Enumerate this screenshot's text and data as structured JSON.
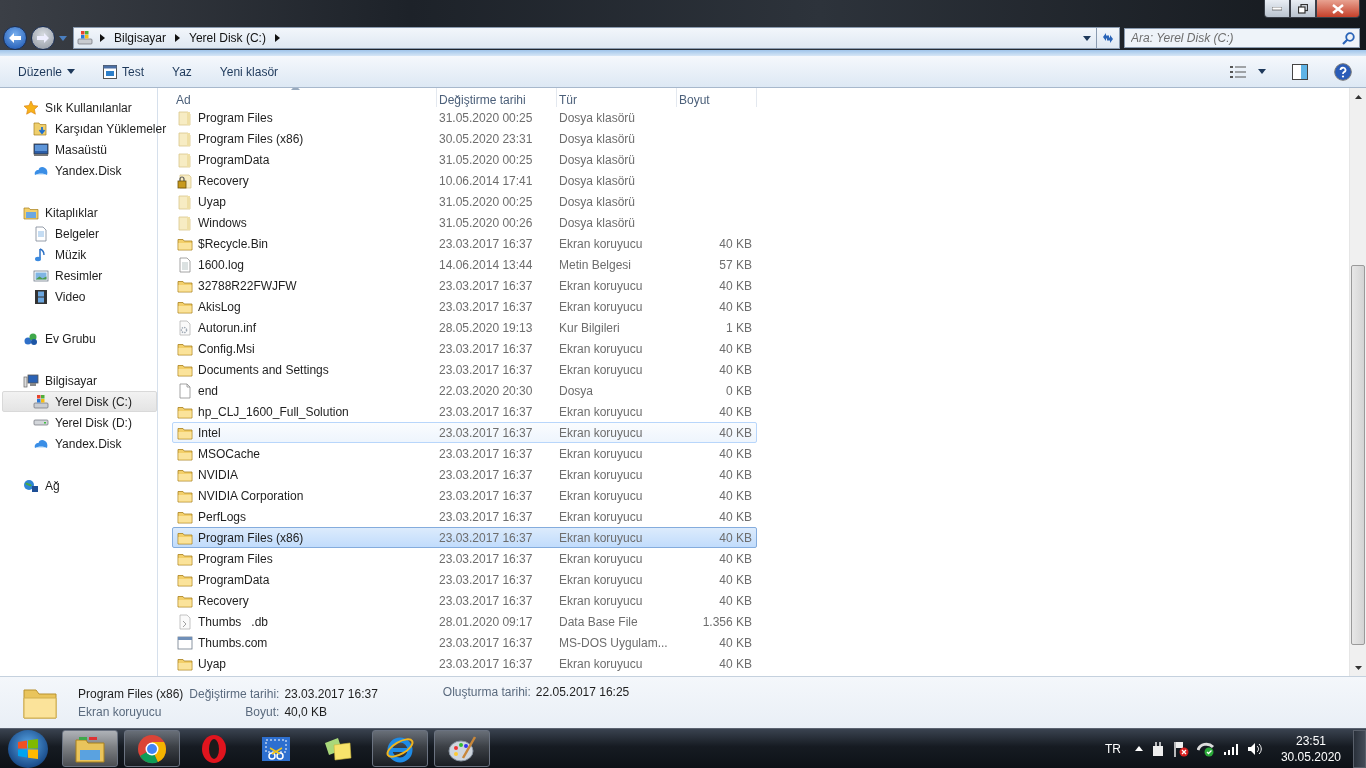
{
  "window": {
    "controls": [
      {
        "kind": "minimize"
      },
      {
        "kind": "restore"
      },
      {
        "kind": "close"
      }
    ]
  },
  "address_bar": {
    "breadcrumbs": [
      "Bilgisayar",
      "Yerel Disk (C:)"
    ]
  },
  "search": {
    "placeholder": "Ara: Yerel Disk (C:)"
  },
  "toolbar": {
    "items": [
      {
        "label": "Düzenle",
        "kind": "menu"
      },
      {
        "label": "Test",
        "kind": "icon"
      },
      {
        "label": "Yaz",
        "kind": "plain"
      },
      {
        "label": "Yeni klasör",
        "kind": "plain"
      }
    ]
  },
  "sidebar": {
    "groups": [
      {
        "label": "Sık Kullanılanlar",
        "kind": "star",
        "selected": false,
        "children": [
          {
            "label": "Karşıdan Yüklemeler",
            "kind": "download",
            "selected": false
          },
          {
            "label": "Masaüstü",
            "kind": "desktop",
            "selected": false
          },
          {
            "label": "Yandex.Disk",
            "kind": "cloud",
            "selected": false
          }
        ]
      },
      {
        "label": "Kitaplıklar",
        "kind": "library",
        "selected": false,
        "children": [
          {
            "label": "Belgeler",
            "kind": "document",
            "selected": false
          },
          {
            "label": "Müzik",
            "kind": "music",
            "selected": false
          },
          {
            "label": "Resimler",
            "kind": "picture",
            "selected": false
          },
          {
            "label": "Video",
            "kind": "film",
            "selected": false
          }
        ]
      },
      {
        "label": "Ev Grubu",
        "kind": "homegroup",
        "selected": false
      },
      {
        "label": "Bilgisayar",
        "kind": "computer",
        "selected": false,
        "children": [
          {
            "label": "Yerel Disk (C:)",
            "kind": "system-drive",
            "selected": true
          },
          {
            "label": "Yerel Disk (D:)",
            "kind": "drive",
            "selected": false
          },
          {
            "label": "Yandex.Disk",
            "kind": "cloud",
            "selected": false
          }
        ]
      },
      {
        "label": "Ağ",
        "kind": "network",
        "selected": false
      }
    ]
  },
  "files": {
    "columns": [
      "Ad",
      "Değiştirme tarihi",
      "Tür",
      "Boyut"
    ],
    "rows": [
      {
        "name": "Program Files",
        "modified": "31.05.2020 00:25",
        "type": "Dosya klasörü",
        "size": "",
        "kind": "pale-folder",
        "selected": false,
        "hovered": false
      },
      {
        "name": "Program Files (x86)",
        "modified": "30.05.2020 23:31",
        "type": "Dosya klasörü",
        "size": "",
        "kind": "pale-folder",
        "selected": false,
        "hovered": false
      },
      {
        "name": "ProgramData",
        "modified": "31.05.2020 00:25",
        "type": "Dosya klasörü",
        "size": "",
        "kind": "pale-folder",
        "selected": false,
        "hovered": false
      },
      {
        "name": "Recovery",
        "modified": "10.06.2014 17:41",
        "type": "Dosya klasörü",
        "size": "",
        "kind": "locked-folder",
        "selected": false,
        "hovered": false
      },
      {
        "name": "Uyap",
        "modified": "31.05.2020 00:25",
        "type": "Dosya klasörü",
        "size": "",
        "kind": "pale-folder",
        "selected": false,
        "hovered": false
      },
      {
        "name": "Windows",
        "modified": "31.05.2020 00:26",
        "type": "Dosya klasörü",
        "size": "",
        "kind": "pale-folder",
        "selected": false,
        "hovered": false
      },
      {
        "name": "$Recycle.Bin",
        "modified": "23.03.2017 16:37",
        "type": "Ekran koruyucu",
        "size": "40 KB",
        "kind": "folder",
        "selected": false,
        "hovered": false
      },
      {
        "name": "1600.log",
        "modified": "14.06.2014 13:44",
        "type": "Metin Belgesi",
        "size": "57 KB",
        "kind": "text",
        "selected": false,
        "hovered": false
      },
      {
        "name": "32788R22FWJFW",
        "modified": "23.03.2017 16:37",
        "type": "Ekran koruyucu",
        "size": "40 KB",
        "kind": "folder",
        "selected": false,
        "hovered": false
      },
      {
        "name": "AkisLog",
        "modified": "23.03.2017 16:37",
        "type": "Ekran koruyucu",
        "size": "40 KB",
        "kind": "folder",
        "selected": false,
        "hovered": false
      },
      {
        "name": "Autorun.inf",
        "modified": "28.05.2020 19:13",
        "type": "Kur Bilgileri",
        "size": "1 KB",
        "kind": "config",
        "selected": false,
        "hovered": false
      },
      {
        "name": "Config.Msi",
        "modified": "23.03.2017 16:37",
        "type": "Ekran koruyucu",
        "size": "40 KB",
        "kind": "folder",
        "selected": false,
        "hovered": false
      },
      {
        "name": "Documents and Settings",
        "modified": "23.03.2017 16:37",
        "type": "Ekran koruyucu",
        "size": "40 KB",
        "kind": "folder",
        "selected": false,
        "hovered": false
      },
      {
        "name": "end",
        "modified": "22.03.2020 20:30",
        "type": "Dosya",
        "size": "0 KB",
        "kind": "blank",
        "selected": false,
        "hovered": false
      },
      {
        "name": "hp_CLJ_1600_Full_Solution",
        "modified": "23.03.2017 16:37",
        "type": "Ekran koruyucu",
        "size": "40 KB",
        "kind": "folder",
        "selected": false,
        "hovered": false
      },
      {
        "name": "Intel",
        "modified": "23.03.2017 16:37",
        "type": "Ekran koruyucu",
        "size": "40 KB",
        "kind": "folder",
        "selected": false,
        "hovered": true
      },
      {
        "name": "MSOCache",
        "modified": "23.03.2017 16:37",
        "type": "Ekran koruyucu",
        "size": "40 KB",
        "kind": "folder",
        "selected": false,
        "hovered": false
      },
      {
        "name": "NVIDIA",
        "modified": "23.03.2017 16:37",
        "type": "Ekran koruyucu",
        "size": "40 KB",
        "kind": "folder",
        "selected": false,
        "hovered": false
      },
      {
        "name": "NVIDIA Corporation",
        "modified": "23.03.2017 16:37",
        "type": "Ekran koruyucu",
        "size": "40 KB",
        "kind": "folder",
        "selected": false,
        "hovered": false
      },
      {
        "name": "PerfLogs",
        "modified": "23.03.2017 16:37",
        "type": "Ekran koruyucu",
        "size": "40 KB",
        "kind": "folder",
        "selected": false,
        "hovered": false
      },
      {
        "name": "Program Files (x86)",
        "modified": "23.03.2017 16:37",
        "type": "Ekran koruyucu",
        "size": "40 KB",
        "kind": "folder",
        "selected": true,
        "hovered": false
      },
      {
        "name": "Program Files",
        "modified": "23.03.2017 16:37",
        "type": "Ekran koruyucu",
        "size": "40 KB",
        "kind": "folder",
        "selected": false,
        "hovered": false
      },
      {
        "name": "ProgramData",
        "modified": "23.03.2017 16:37",
        "type": "Ekran koruyucu",
        "size": "40 KB",
        "kind": "folder",
        "selected": false,
        "hovered": false
      },
      {
        "name": "Recovery",
        "modified": "23.03.2017 16:37",
        "type": "Ekran koruyucu",
        "size": "40 KB",
        "kind": "folder",
        "selected": false,
        "hovered": false
      },
      {
        "name": "Thumbs   .db",
        "modified": "28.01.2020 09:17",
        "type": "Data Base File",
        "size": "1.356 KB",
        "kind": "data",
        "selected": false,
        "hovered": false
      },
      {
        "name": "Thumbs.com",
        "modified": "23.03.2017 16:37",
        "type": "MS-DOS Uygulam...",
        "size": "40 KB",
        "kind": "program",
        "selected": false,
        "hovered": false
      },
      {
        "name": "Uyap",
        "modified": "23.03.2017 16:37",
        "type": "Ekran koruyucu",
        "size": "40 KB",
        "kind": "folder",
        "selected": false,
        "hovered": false
      }
    ]
  },
  "details": {
    "name": "Program Files (x86)",
    "type": "Ekran koruyucu",
    "fields": [
      {
        "label": "Değiştirme tarihi:",
        "value": "23.03.2017 16:37"
      },
      {
        "label": "Boyut:",
        "value": "40,0 KB"
      },
      {
        "label": "Oluşturma tarihi:",
        "value": "22.05.2017 16:25"
      }
    ]
  },
  "taskbar": {
    "apps": [
      {
        "kind": "explorer",
        "running": true
      },
      {
        "kind": "chrome",
        "running": true
      },
      {
        "kind": "opera",
        "running": false
      },
      {
        "kind": "snipping",
        "running": false
      },
      {
        "kind": "sticky-notes",
        "running": false
      },
      {
        "kind": "ie",
        "running": true
      },
      {
        "kind": "paint",
        "running": true
      }
    ],
    "language": "TR",
    "time": "23:51",
    "date": "30.05.2020"
  }
}
